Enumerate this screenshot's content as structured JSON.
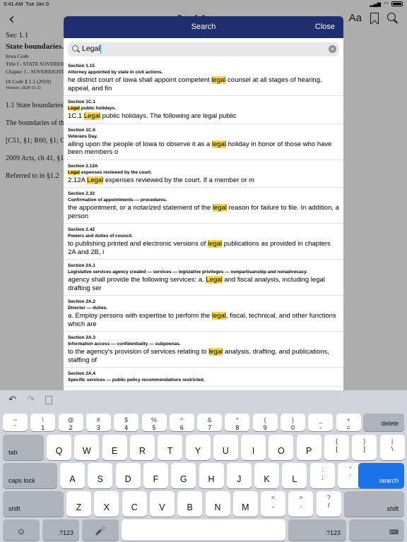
{
  "status_bar": {
    "time": "9:41 AM",
    "date": "Tue Jan 9"
  },
  "nav": {
    "title": "Sec 1.1",
    "aa_label": "Aa"
  },
  "document": {
    "section": "Sec 1.1",
    "heading": "State boundaries.",
    "code": "Iowa Code",
    "title_line": "Title I - STATE SOVEREIGNTY",
    "chapter_line": "Chapter 1 - SOVEREIGNTY",
    "citation": "IA Code § 1.1 (2019)",
    "version": "Version | 2020-11-21",
    "para1": "1.1 State boundaries",
    "para2": "The boundaries of the",
    "para3": "[C51, §1; R60, §1; C",
    "para4": "2009 Acts, ch 41, §1",
    "para5": "Referred to in §1.2"
  },
  "modal": {
    "title": "Search",
    "close_label": "Close",
    "search_value": "Legal"
  },
  "results": [
    {
      "section": "Section 1.15",
      "title": "Attorney appointed by state in civil actions.",
      "before": "he district court of Iowa shall appoint competent ",
      "hit": "legal",
      "after": " counsel at all stages of hearing, appeal, and fin",
      "title_hit": "",
      "title_rest": ""
    },
    {
      "section": "Section 1C.1",
      "title_hit": "Legal",
      "title_rest": " public holidays.",
      "before": "1C.1 ",
      "hit": "Legal",
      "after": " public holidays.  The following are legal public"
    },
    {
      "section": "Section 1C.6",
      "title": "Veterans Day.",
      "before": "alling upon the people of Iowa to observe it as a ",
      "hit": "legal",
      "after": " holiday in honor of those who have been members o",
      "title_hit": "",
      "title_rest": ""
    },
    {
      "section": "Section 2.12A",
      "title_hit": "Legal",
      "title_rest": " expenses reviewed by the court.",
      "before": "2.12A ",
      "hit": "Legal",
      "after": " expenses reviewed by the court.  If a member or m"
    },
    {
      "section": "Section 2.32",
      "title": "Confirmation of appointments — procedures.",
      "before": " the appointment, or a notarized statement of the ",
      "hit": "legal",
      "after": " reason for failure to file. In addition, a person",
      "title_hit": "",
      "title_rest": ""
    },
    {
      "section": "Section 2.42",
      "title": "Powers and duties of council.",
      "before": " to publishing printed and electronic versions of ",
      "hit": "legal",
      "after": " publications as provided in chapters 2A and 2B, i",
      "title_hit": "",
      "title_rest": ""
    },
    {
      "section": "Section 2A.1",
      "title": "Legislative services agency created — services — legislative privileges — nonpartisanship and nonadvocacy.",
      "before": " agency shall provide the following services:  a. ",
      "hit": "Legal",
      "after": " and fiscal analysis, including legal drafting ser",
      "title_hit": "",
      "title_rest": ""
    },
    {
      "section": "Section 2A.2",
      "title": "Director — duties.",
      "before": "  a. Employ persons with expertise to perform the ",
      "hit": "legal",
      "after": ", fiscal, technical, and other functions which are",
      "title_hit": "",
      "title_rest": ""
    },
    {
      "section": "Section 2A.3",
      "title": "Information access — confidentiality — subpoenas.",
      "before": "to the agency's provision of services relating to ",
      "hit": "legal",
      "after": " analysis, drafting, and publications, staffing of",
      "title_hit": "",
      "title_rest": ""
    },
    {
      "section": "Section 2A.4",
      "title": "Specific services — public policy recommendations restricted.",
      "before": "",
      "hit": "",
      "after": "",
      "title_hit": "",
      "title_rest": ""
    }
  ],
  "keyboard": {
    "toolbar": {
      "undo": "↶",
      "redo": "↷",
      "paste": "📋"
    },
    "row1": [
      {
        "top": "~",
        "bot": "`"
      },
      {
        "top": "!",
        "bot": "1"
      },
      {
        "top": "@",
        "bot": "2"
      },
      {
        "top": "#",
        "bot": "3"
      },
      {
        "top": "$",
        "bot": "4"
      },
      {
        "top": "%",
        "bot": "5"
      },
      {
        "top": "^",
        "bot": "6"
      },
      {
        "top": "&",
        "bot": "7"
      },
      {
        "top": "*",
        "bot": "8"
      },
      {
        "top": "(",
        "bot": "9"
      },
      {
        "top": ")",
        "bot": "0"
      },
      {
        "top": "_",
        "bot": "-"
      },
      {
        "top": "+",
        "bot": "="
      }
    ],
    "delete": "delete",
    "tab": "tab",
    "row2": [
      "Q",
      "W",
      "E",
      "R",
      "T",
      "Y",
      "U",
      "I",
      "O",
      "P"
    ],
    "row2_extra": [
      {
        "top": "{",
        "bot": "["
      },
      {
        "top": "}",
        "bot": "]"
      },
      {
        "top": "|",
        "bot": "\\"
      }
    ],
    "caps": "caps lock",
    "row3": [
      "A",
      "S",
      "D",
      "F",
      "G",
      "H",
      "J",
      "K",
      "L"
    ],
    "row3_extra": [
      {
        "top": ":",
        "bot": ";"
      },
      {
        "top": "\"",
        "bot": "'"
      }
    ],
    "search": "search",
    "shift": "shift",
    "row4": [
      "Z",
      "X",
      "C",
      "V",
      "B",
      "N",
      "M"
    ],
    "row4_extra": [
      {
        "top": "<",
        "bot": ","
      },
      {
        "top": ">",
        "bot": "."
      },
      {
        "top": "?",
        "bot": "/"
      }
    ],
    "numbers": ".?123",
    "emoji": "☺",
    "mic": "🎤",
    "hide": "⌨"
  },
  "colors": {
    "header": "#1e2e6e",
    "highlight": "#f6d548",
    "search_key": "#1a73e8"
  }
}
